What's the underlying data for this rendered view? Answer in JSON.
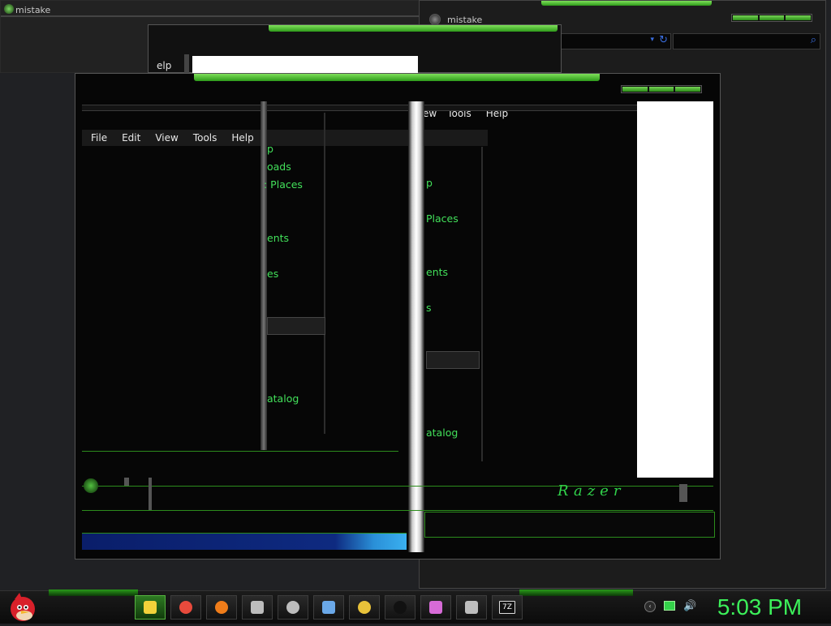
{
  "windows": {
    "back_top_left": {
      "title": "mistake"
    },
    "back_right": {
      "title": "mistake",
      "search_icon": "search-icon",
      "refresh_icon": "refresh-icon"
    },
    "middle": {
      "menu_fragment": "elp"
    },
    "front": {
      "menu": [
        "File",
        "Edit",
        "View",
        "Tools",
        "Help"
      ]
    },
    "behind_front": {
      "menu": [
        "ew",
        "Tools",
        "Help"
      ]
    },
    "left_pane_places": [
      "p",
      "oads",
      ": Places",
      "ents",
      "es",
      "atalog"
    ],
    "right_pane_places": [
      "p",
      "Places",
      "ents",
      "s",
      "atalog"
    ],
    "branding": "Razer"
  },
  "taskbar": {
    "start_icon": "angry-bird-red-icon",
    "buttons": [
      {
        "name": "file-manager-icon",
        "color": "#f2d23a",
        "active": true
      },
      {
        "name": "chrome-icon",
        "color": "#e84a3c",
        "active": false
      },
      {
        "name": "firefox-icon",
        "color": "#f07d1a",
        "active": false
      },
      {
        "name": "speaker-icon",
        "color": "#bdbdbd",
        "active": false
      },
      {
        "name": "browser-globe-icon",
        "color": "#bdbdbd",
        "active": false
      },
      {
        "name": "keyboard-icon",
        "color": "#6aa8e8",
        "active": false
      },
      {
        "name": "media-player-icon",
        "color": "#e8c23a",
        "active": false
      },
      {
        "name": "black-circle-icon",
        "color": "#111111",
        "active": false
      },
      {
        "name": "paint-icon",
        "color": "#d86bd8",
        "active": false
      },
      {
        "name": "display-settings-icon",
        "color": "#bdbdbd",
        "active": false
      },
      {
        "name": "archive-7z-icon",
        "color": "#e8e8e8",
        "active": false
      }
    ],
    "archive_label": "7Z",
    "tray_icons": [
      "arrow-tray-icon",
      "monitor-tray-icon",
      "volume-tray-icon"
    ],
    "clock": "5:03 PM"
  },
  "colors": {
    "accent": "#42e05a",
    "clock": "#3cf05a",
    "background": "#202124"
  }
}
